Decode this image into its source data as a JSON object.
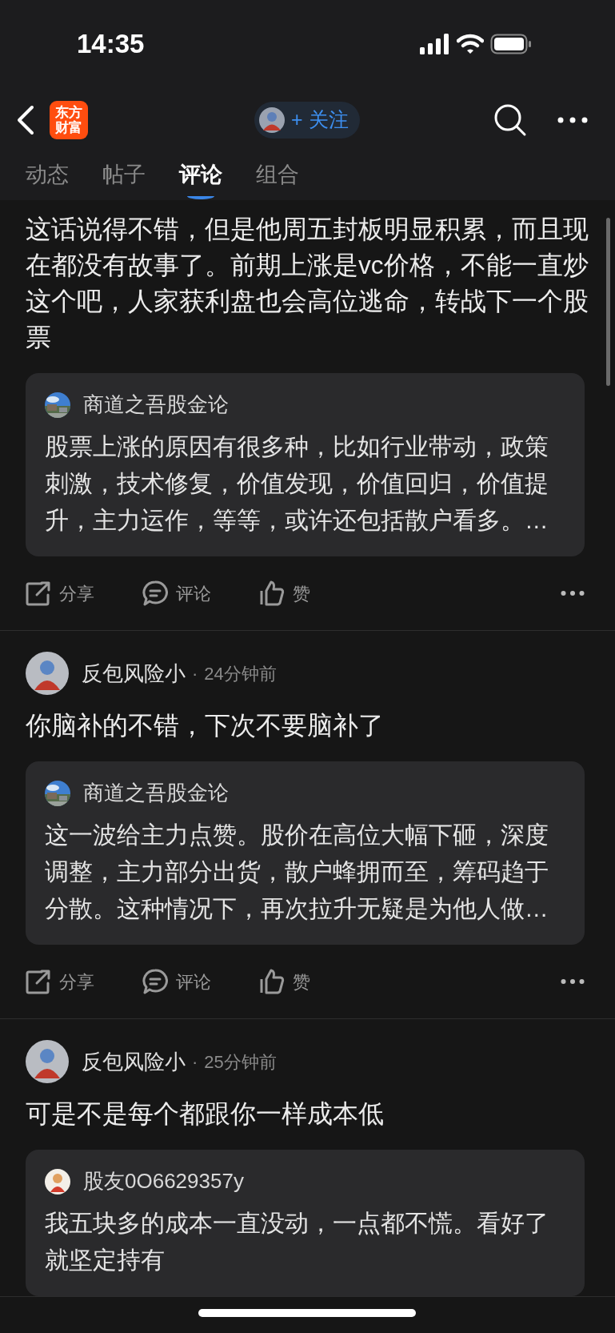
{
  "status_bar": {
    "time": "14:35"
  },
  "nav": {
    "logo_lines": [
      "东方",
      "财富"
    ],
    "follow_label": "+ 关注"
  },
  "tabs": [
    {
      "label": "动态",
      "selected": false
    },
    {
      "label": "帖子",
      "selected": false
    },
    {
      "label": "评论",
      "selected": true
    },
    {
      "label": "组合",
      "selected": false
    }
  ],
  "comments": [
    {
      "text": "这话说得不错，但是他周五封板明显积累，而且现在都没有故事了。前期上涨是vc价格，不能一直炒这个吧，人家获利盘也会高位逃命，转战下一个股票",
      "quote": {
        "author": "商道之吾股金论",
        "text": "股票上涨的原因有很多种，比如行业带动，政策刺激，技术修复，价值发现，价值回归，价值提升，主力运作，等等，或许还包括散户看多。…"
      },
      "actions": [
        "分享",
        "评论",
        "赞"
      ]
    },
    {
      "author": "反包风险小",
      "separator": "·",
      "time": "24分钟前",
      "text": "你脑补的不错，下次不要脑补了",
      "quote": {
        "author": "商道之吾股金论",
        "text": "这一波给主力点赞。股价在高位大幅下砸，深度调整，主力部分出货，散户蜂拥而至，筹码趋于分散。这种情况下，再次拉升无疑是为他人做…"
      },
      "actions": [
        "分享",
        "评论",
        "赞"
      ]
    },
    {
      "author": "反包风险小",
      "separator": "·",
      "time": "25分钟前",
      "text": "可是不是每个都跟你一样成本低",
      "quote": {
        "author": "股友0O6629357y",
        "avatar": {
          "kind": "figure"
        },
        "text": "我五块多的成本一直没动，一点都不慌。看好了就坚定持有"
      }
    }
  ]
}
